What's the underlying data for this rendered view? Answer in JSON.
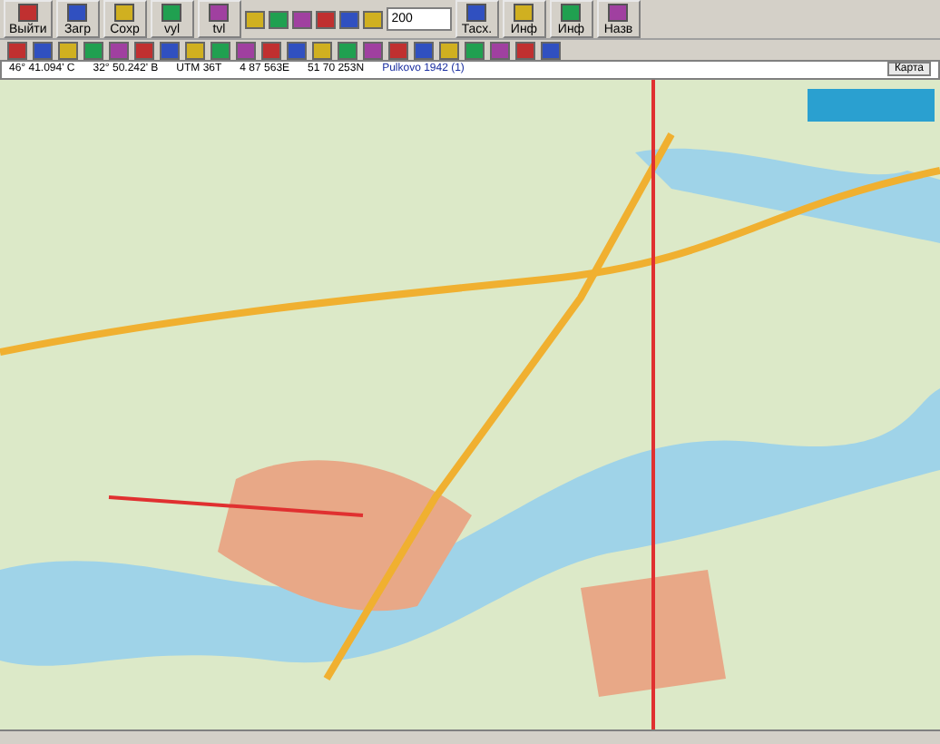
{
  "toolbar": {
    "buttons": [
      {
        "label": "Выйти"
      },
      {
        "label": "Загр"
      },
      {
        "label": "Сохр"
      },
      {
        "label": "vyl"
      },
      {
        "label": "tvl"
      }
    ],
    "scale": {
      "value": "200"
    },
    "right_buttons": [
      {
        "label": "Тасх."
      },
      {
        "label": "Инф"
      },
      {
        "label": "Инф"
      },
      {
        "label": "Назв"
      }
    ]
  },
  "coordinates": {
    "latitude": "46° 41.094' С",
    "longitude": "32° 50.242' В",
    "zone": "UTM  36T",
    "easting": "4 87 563E",
    "northing": "51 70 253N",
    "datum": "Pulkovo 1942 (1)"
  },
  "view_tabs": [
    {
      "label": "Карта",
      "selected": true
    }
  ]
}
